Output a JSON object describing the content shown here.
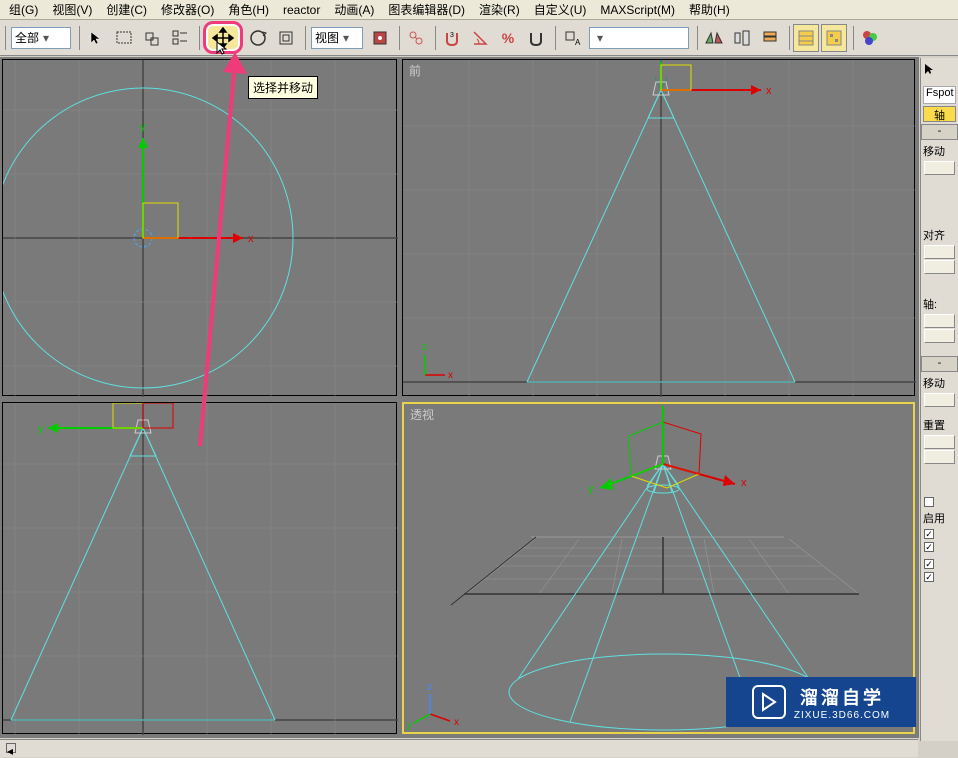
{
  "menu": {
    "items": [
      "组(G)",
      "视图(V)",
      "创建(C)",
      "修改器(O)",
      "角色(H)",
      "reactor",
      "动画(A)",
      "图表编辑器(D)",
      "渲染(R)",
      "自定义(U)",
      "MAXScript(M)",
      "帮助(H)"
    ]
  },
  "toolbar": {
    "filter_dropdown": "全部",
    "coord_dropdown": "视图",
    "tooltip": "选择并移动"
  },
  "viewports": {
    "front": "前",
    "perspective": "透视"
  },
  "rightpanel": {
    "object_name": "Fspot",
    "axis_btn": "轴",
    "section1": "-",
    "move_label": "移动",
    "align_label": "对齐",
    "axis_group": "轴:",
    "section2": "-",
    "move2": "移动",
    "reset": "重置",
    "enable": "启用"
  },
  "watermark": {
    "cn": "溜溜自学",
    "en": "ZIXUE.3D66.COM"
  },
  "axes": {
    "x": "x",
    "y": "y",
    "z": "z"
  }
}
